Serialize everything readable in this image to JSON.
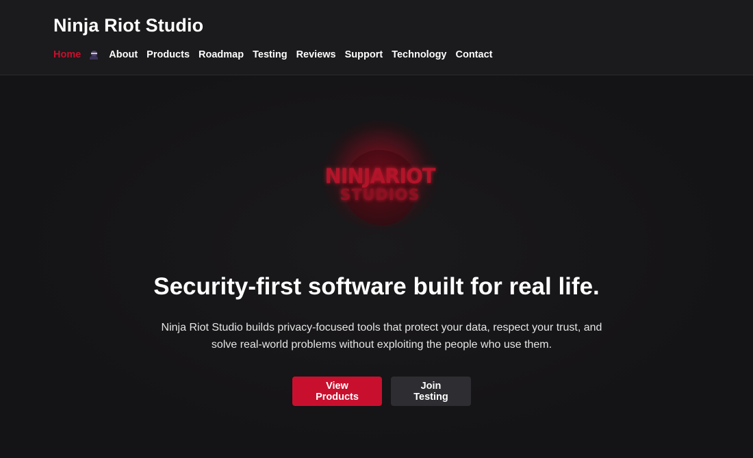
{
  "header": {
    "brand": "Ninja Riot Studio",
    "nav": [
      {
        "label": "Home",
        "active": true
      },
      {
        "label": "About"
      },
      {
        "label": "Products"
      },
      {
        "label": "Roadmap"
      },
      {
        "label": "Testing"
      },
      {
        "label": "Reviews"
      },
      {
        "label": "Support"
      },
      {
        "label": "Technology"
      },
      {
        "label": "Contact"
      }
    ],
    "nav_icon": "ninja-emoji-icon"
  },
  "hero": {
    "logo": {
      "line1": "NINJARIOT",
      "line2": "STUDIOS"
    },
    "headline": "Security-first software built for real life.",
    "subtext": "Ninja Riot Studio builds privacy-focused tools that protect your data, respect your trust, and solve real-world problems without exploiting the people who use them.",
    "buttons": {
      "primary": "View Products",
      "secondary": "Join Testing"
    }
  },
  "colors": {
    "accent": "#c8102e",
    "background": "#141315",
    "header_bg": "#1b1a1c",
    "secondary_button": "#2e2d31"
  }
}
